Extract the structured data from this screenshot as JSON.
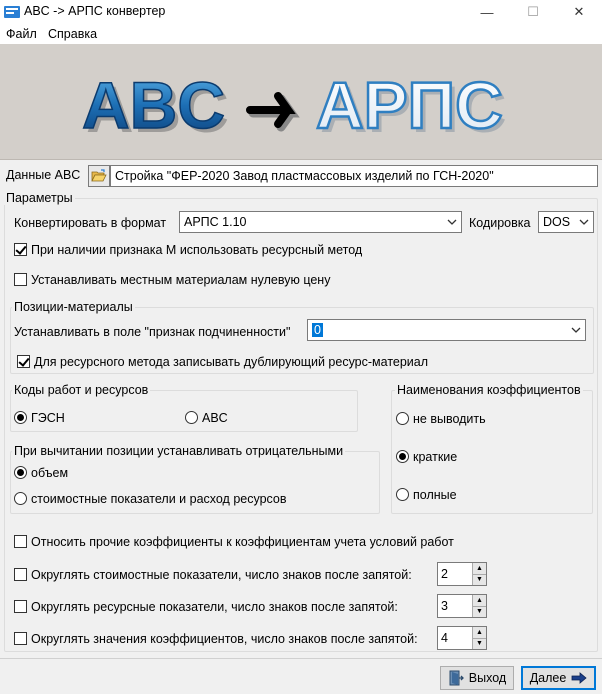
{
  "window": {
    "title": "ABC -> АРПС конвертер",
    "minimize": "—",
    "maximize": "☐",
    "close": "✕"
  },
  "menu": {
    "items": [
      "Файл",
      "Справка"
    ]
  },
  "banner": {
    "left": "ABC",
    "right": "АРПС"
  },
  "data_abc": {
    "label": "Данные ABC",
    "value": "Стройка \"ФЕР-2020 Завод пластмассовых изделий по ГСН-2020\""
  },
  "params": {
    "title": "Параметры",
    "format_label": "Конвертировать в формат",
    "format_value": "АРПС 1.10",
    "encoding_label": "Кодировка",
    "encoding_value": "DOS",
    "cb_resource_method": {
      "label": "При наличии признака М использовать ресурсный метод",
      "checked": true
    },
    "cb_local_zero": {
      "label": "Устанавливать местным материалам нулевую цену",
      "checked": false
    }
  },
  "positions": {
    "title": "Позиции-материалы",
    "subordination_label": "Устанавливать в поле \"признак подчиненности\"",
    "subordination_value": "0",
    "cb_duplicate": {
      "label": "Для ресурсного метода записывать дублирующий ресурс-материал",
      "checked": true
    }
  },
  "codes": {
    "title": "Коды работ и ресурсов",
    "options": [
      {
        "label": "ГЭСН",
        "checked": true
      },
      {
        "label": "ABC",
        "checked": false
      }
    ]
  },
  "coef_names": {
    "title": "Наименования коэффициентов",
    "options": [
      {
        "label": "не выводить",
        "checked": false
      },
      {
        "label": "краткие",
        "checked": true
      },
      {
        "label": "полные",
        "checked": false
      }
    ]
  },
  "subtract": {
    "title": "При вычитании позиции устанавливать отрицательными",
    "options": [
      {
        "label": "объем",
        "checked": true
      },
      {
        "label": "стоимостные показатели и расход ресурсов",
        "checked": false
      }
    ]
  },
  "bottom": {
    "cb_other_coef": {
      "label": "Относить прочие коэффициенты к коэффициентам учета условий работ",
      "checked": false
    },
    "round_cost": {
      "label": "Округлять стоимостные показатели, число знаков после запятой:",
      "checked": false,
      "value": "2"
    },
    "round_res": {
      "label": "Округлять ресурсные показатели, число знаков после запятой:",
      "checked": false,
      "value": "3"
    },
    "round_coef": {
      "label": "Округлять значения коэффициентов, число знаков после запятой:",
      "checked": false,
      "value": "4"
    }
  },
  "buttons": {
    "exit": "Выход",
    "next": "Далее"
  },
  "colors": {
    "banner_bg": "#d3cfca",
    "accent": "#0078d7",
    "logo_blue": "#1a6fb0"
  },
  "icons": {
    "folder": "folder-open-icon",
    "exit": "door-exit-icon",
    "next": "arrow-right-icon"
  }
}
